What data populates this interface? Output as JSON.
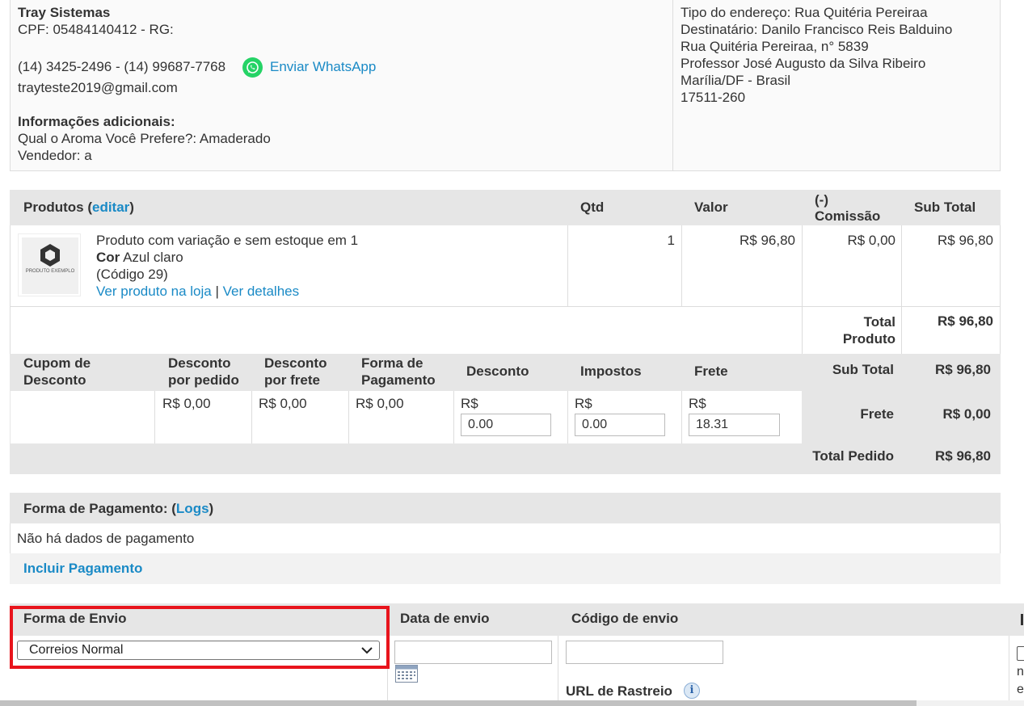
{
  "customer": {
    "name": "Tray Sistemas",
    "doc": "CPF: 05484140412 - RG:",
    "phones": "(14) 3425-2496 - (14) 99687-7768",
    "whatsapp_label": "Enviar WhatsApp",
    "email": "trayteste2019@gmail.com",
    "additional_title": "Informações adicionais:",
    "additional_line1": "Qual o Aroma Você Prefere?: Amaderado",
    "additional_line2": "Vendedor: a"
  },
  "address": {
    "line1": "Tipo do endereço: Rua Quitéria Pereiraa",
    "line2": "Destinatário: Danilo Francisco Reis Balduino",
    "line3": "Rua Quitéria Pereiraa, n° 5839",
    "line4": "Professor José Augusto da Silva Ribeiro",
    "line5": "Marília/DF - Brasil",
    "line6": "17511-260"
  },
  "products": {
    "header_label": "Produtos (",
    "edit_link": "editar",
    "header_close": ")",
    "col_qtd": "Qtd",
    "col_valor": "Valor",
    "col_comissao_1": "(-)",
    "col_comissao_2": "Comissão",
    "col_subtotal": "Sub Total",
    "item": {
      "name": "Produto com variação e sem estoque em 1",
      "attr_label": "Cor",
      "attr_value": " Azul claro",
      "code": "(Código 29)",
      "link_store": "Ver produto na loja",
      "sep": " | ",
      "link_details": "Ver detalhes",
      "qty": "1",
      "value": "R$ 96,80",
      "commission": "R$ 0,00",
      "subtotal": "R$ 96,80",
      "thumb_text": "PRODUTO EXEMPLO"
    },
    "total_produto_label_1": "Total",
    "total_produto_label_2": "Produto",
    "total_produto_value": "R$ 96,80"
  },
  "discounts": {
    "col_cupom_1": "Cupom de",
    "col_cupom_2": "Desconto",
    "col_desc_pedido_1": "Desconto",
    "col_desc_pedido_2": "por pedido",
    "col_desc_frete_1": "Desconto",
    "col_desc_frete_2": "por frete",
    "col_forma_pag_1": "Forma de",
    "col_forma_pag_2": "Pagamento",
    "col_desconto": "Desconto",
    "col_impostos": "Impostos",
    "col_frete": "Frete",
    "val_desc_pedido": "R$ 0,00",
    "val_desc_frete": "R$ 0,00",
    "val_forma_pag": "R$ 0,00",
    "currency": "R$",
    "input_desconto": "0.00",
    "input_impostos": "0.00",
    "input_frete": "18.31"
  },
  "totals": {
    "subtotal_label": "Sub Total",
    "subtotal_value": "R$ 96,80",
    "frete_label": "Frete",
    "frete_value": "R$ 0,00",
    "total_label": "Total Pedido",
    "total_value": "R$ 96,80"
  },
  "payment": {
    "title": "Forma de Pagamento: (",
    "logs_link": "Logs",
    "title_close": ")",
    "empty_text": "Não há dados de pagamento",
    "include_link": "Incluir Pagamento"
  },
  "shipping": {
    "col_forma_envio": "Forma de Envio",
    "col_data_envio": "Data de envio",
    "col_codigo_envio": "Código de envio",
    "selected_method": "Correios Normal",
    "url_rastreio": "URL de Rastreio",
    "highlight_color": "#e8141c"
  }
}
